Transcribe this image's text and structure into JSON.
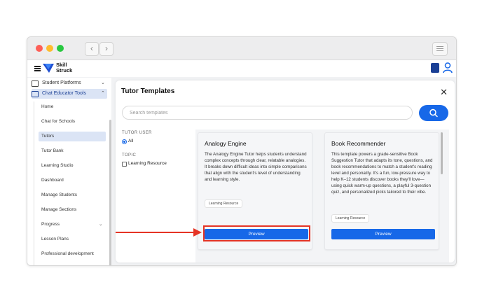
{
  "brand": {
    "logo_line1": "Skill",
    "logo_line2": "Struck"
  },
  "sidebar": {
    "top_items": [
      {
        "label": "Student Platforms",
        "icon": "monitor-icon"
      },
      {
        "label": "Chat Educator Tools",
        "icon": "chat-icon"
      }
    ],
    "sub_items": [
      {
        "label": "Home"
      },
      {
        "label": "Chat for Schools"
      },
      {
        "label": "Tutors"
      },
      {
        "label": "Tutor Bank"
      },
      {
        "label": "Learning Studio"
      },
      {
        "label": "Dashboard"
      },
      {
        "label": "Manage Students"
      },
      {
        "label": "Manage Sections"
      },
      {
        "label": "Progress"
      },
      {
        "label": "Lesson Plans"
      },
      {
        "label": "Professional development"
      }
    ],
    "selected": "Tutors"
  },
  "modal": {
    "title": "Tutor Templates",
    "search_placeholder": "Search templates",
    "filters": {
      "tutor_user_heading": "TUTOR USER",
      "tutor_user_option": "All",
      "topic_heading": "TOPIC",
      "topic_option": "Learning Resource"
    },
    "cards": [
      {
        "title": "Analogy Engine",
        "description": "The Analogy Engine Tutor helps students understand complex concepts through clear, relatable analogies. It breaks down difficult ideas into simple comparisons that align with the student's level of understanding and learning style.",
        "tag": "Learning Resource",
        "button": "Preview"
      },
      {
        "title": "Book Recommender",
        "description": "This template powers a grade-sensitive Book Suggestion Tutor that adapts its tone, questions, and book recommendations to match a student's reading level and personality. It's a fun, low-pressure way to help K–12 students discover books they'll love—using quick warm-up questions, a playful 3-question quiz, and personalized picks tailored to their vibe.",
        "tag": "Learning Resource",
        "button": "Preview"
      }
    ]
  },
  "colors": {
    "accent": "#1768e8",
    "annotation": "#e53425",
    "nav_dark": "#1a3f95"
  }
}
